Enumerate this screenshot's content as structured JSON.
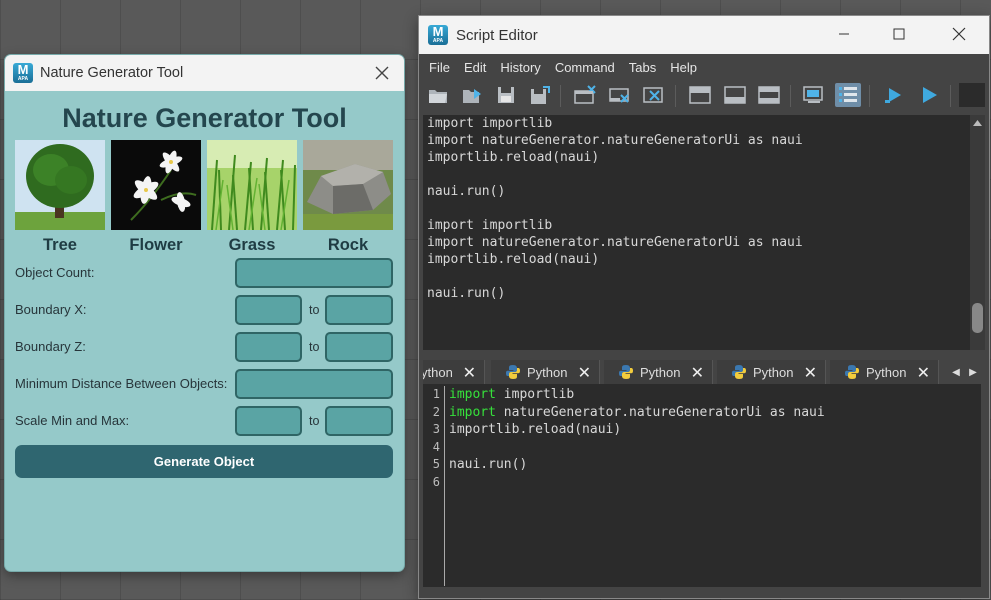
{
  "nature_tool": {
    "window_title": "Nature Generator Tool",
    "logo_text": "M",
    "logo_sub": "APA",
    "heading": "Nature Generator Tool",
    "images": [
      {
        "label": "Tree"
      },
      {
        "label": "Flower"
      },
      {
        "label": "Grass"
      },
      {
        "label": "Rock"
      }
    ],
    "fields": {
      "object_count_label": "Object Count:",
      "boundary_x_label": "Boundary X:",
      "boundary_z_label": "Boundary Z:",
      "min_distance_label": "Minimum Distance Between Objects:",
      "scale_label": "Scale Min and Max:",
      "to_text": "to"
    },
    "generate_button": "Generate Object"
  },
  "script_editor": {
    "window_title": "Script Editor",
    "logo_text": "M",
    "logo_sub": "APA",
    "menu": [
      "File",
      "Edit",
      "History",
      "Command",
      "Tabs",
      "Help"
    ],
    "history_lines": [
      "import importlib",
      "import natureGenerator.natureGeneratorUi as naui",
      "importlib.reload(naui)",
      "",
      "naui.run()",
      "",
      "import importlib",
      "import natureGenerator.natureGeneratorUi as naui",
      "importlib.reload(naui)",
      "",
      "naui.run()"
    ],
    "tabs": [
      {
        "label": "ython"
      },
      {
        "label": "Python"
      },
      {
        "label": "Python"
      },
      {
        "label": "Python"
      },
      {
        "label": "Python"
      }
    ],
    "code_lines": [
      {
        "num": "1",
        "kw": "import",
        "rest": " importlib"
      },
      {
        "num": "2",
        "kw": "import",
        "rest": " natureGenerator.natureGeneratorUi as naui"
      },
      {
        "num": "3",
        "kw": "",
        "rest": "importlib.reload(naui)"
      },
      {
        "num": "4",
        "kw": "",
        "rest": ""
      },
      {
        "num": "5",
        "kw": "",
        "rest": "naui.run()"
      },
      {
        "num": "6",
        "kw": "",
        "rest": ""
      }
    ]
  }
}
